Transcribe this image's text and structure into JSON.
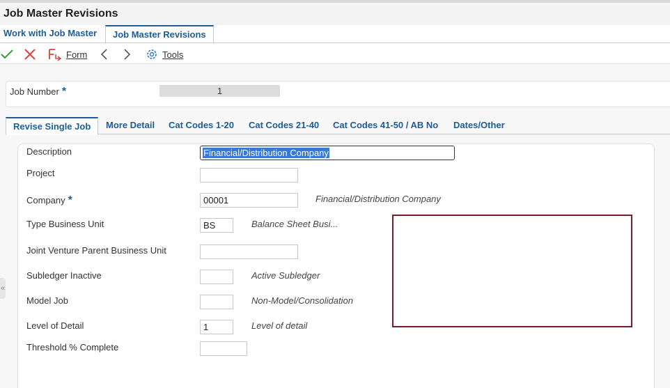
{
  "window": {
    "title": "Job Master Revisions"
  },
  "app_tabs": [
    {
      "label": "Work with Job Master",
      "active": false
    },
    {
      "label": "Job Master Revisions",
      "active": true
    }
  ],
  "toolbar": {
    "ok_icon": "checkmark-icon",
    "cancel_icon": "close-icon",
    "form_menu": {
      "icon": "form-icon",
      "label": "Form",
      "hotkey": "F"
    },
    "prev_icon": "chevron-left-icon",
    "next_icon": "chevron-right-icon",
    "tools_menu": {
      "icon": "gear-icon",
      "label": "Tools",
      "hotkey": "T"
    }
  },
  "header": {
    "job_number_label": "Job Number",
    "job_number_value": "1",
    "required_marker": "*"
  },
  "form_tabs": [
    {
      "label": "Revise Single Job",
      "active": true
    },
    {
      "label": "More Detail",
      "active": false
    },
    {
      "label": "Cat Codes 1-20",
      "active": false
    },
    {
      "label": "Cat Codes 21-40",
      "active": false
    },
    {
      "label": "Cat Codes 41-50 / AB No",
      "active": false
    },
    {
      "label": "Dates/Other",
      "active": false
    }
  ],
  "fields": {
    "description": {
      "label": "Description",
      "value": "Financial/Distribution Company"
    },
    "project": {
      "label": "Project",
      "value": ""
    },
    "company": {
      "label": "Company",
      "value": "00001",
      "hint": "Financial/Distribution Company",
      "required_marker": "*"
    },
    "type_business_unit": {
      "label": "Type Business Unit",
      "value": "BS",
      "hint": "Balance Sheet Busi..."
    },
    "joint_venture": {
      "label": "Joint Venture Parent Business Unit",
      "value": ""
    },
    "subledger_inactive": {
      "label": "Subledger Inactive",
      "value": "",
      "hint": "Active Subledger"
    },
    "model_job": {
      "label": "Model Job",
      "value": "",
      "hint": "Non-Model/Consolidation"
    },
    "level_of_detail": {
      "label": "Level of Detail",
      "value": "1",
      "hint": "Level of detail"
    },
    "threshold": {
      "label": "Threshold % Complete",
      "value": ""
    }
  },
  "colors": {
    "link_blue": "#1c5d99",
    "ok_green": "#3a9a3a",
    "cancel_red": "#d9443a",
    "highlight_box": "#7b1a2d",
    "selection": "#3a78d6"
  }
}
